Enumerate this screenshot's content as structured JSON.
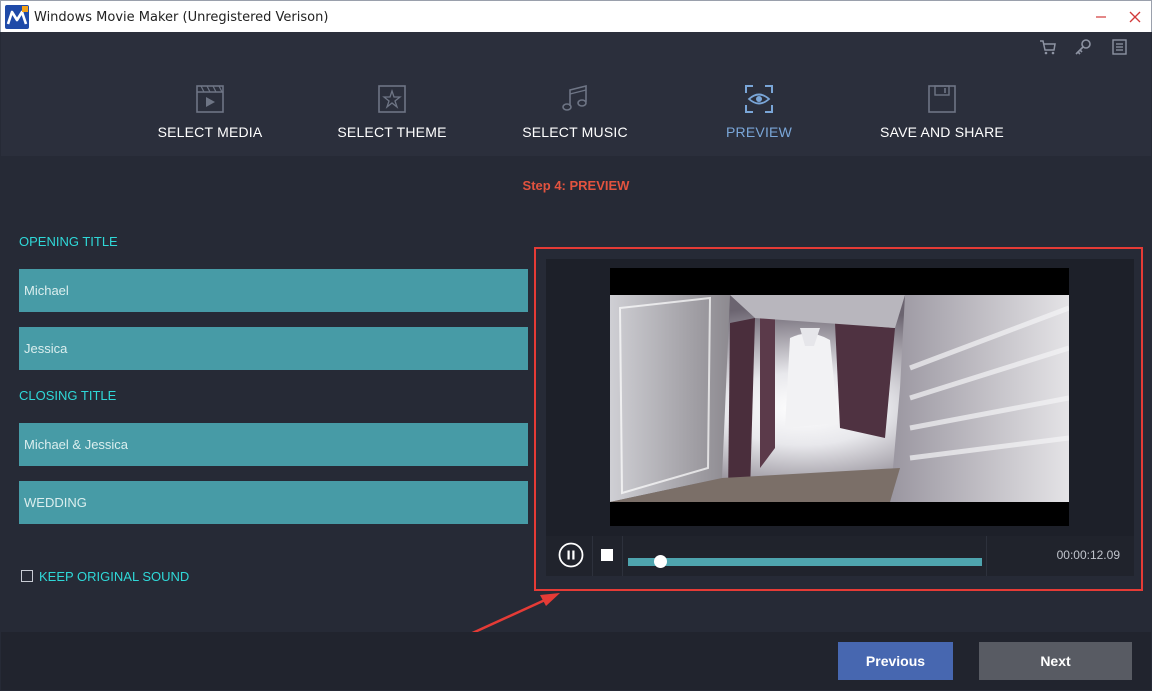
{
  "window": {
    "title": "Windows Movie Maker (Unregistered Verison)",
    "minimize_icon": "minimize-icon",
    "close_icon": "close-icon"
  },
  "top_icons": [
    "cart-icon",
    "key-icon",
    "menu-icon"
  ],
  "steps": [
    {
      "label": "SELECT MEDIA",
      "icon": "film-icon",
      "active": false
    },
    {
      "label": "SELECT THEME",
      "icon": "theme-star-icon",
      "active": false
    },
    {
      "label": "SELECT MUSIC",
      "icon": "music-note-icon",
      "active": false
    },
    {
      "label": "PREVIEW",
      "icon": "preview-eye-icon",
      "active": true
    },
    {
      "label": "SAVE AND SHARE",
      "icon": "save-disk-icon",
      "active": false
    }
  ],
  "main": {
    "step_title": "Step 4: PREVIEW",
    "opening_title_label": "OPENING TITLE",
    "opening_fields": [
      "Michael",
      "Jessica"
    ],
    "closing_title_label": "CLOSING TITLE",
    "closing_fields": [
      "Michael & Jessica",
      "WEDDING"
    ],
    "keep_sound_label": "KEEP ORIGINAL SOUND",
    "keep_sound_checked": false
  },
  "player": {
    "time": "00:00:12.09",
    "progress": 0.09
  },
  "footer": {
    "previous_label": "Previous",
    "next_label": "Next"
  },
  "colors": {
    "accent_teal": "#2fd8d8",
    "field_bg": "#479ba6",
    "step_title": "#e2533f",
    "highlight": "#e53b36",
    "active_step": "#7aa6d8"
  }
}
